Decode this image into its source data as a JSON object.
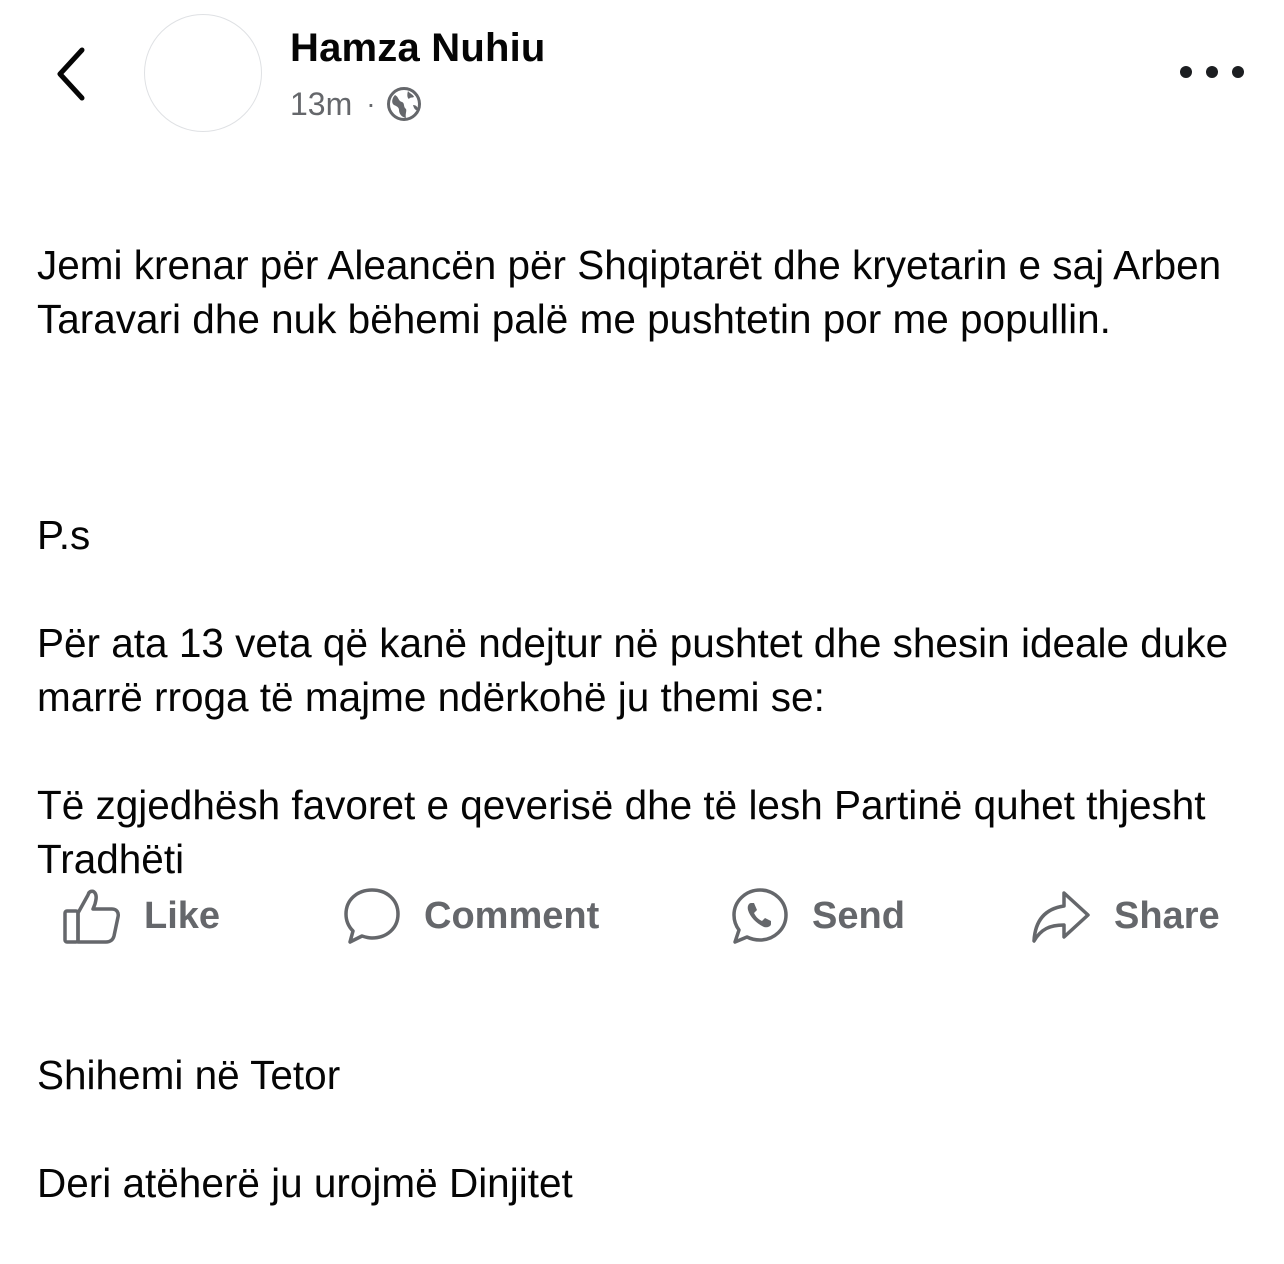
{
  "header": {
    "author": "Hamza Nuhiu",
    "timestamp": "13m",
    "separator": "·",
    "audience_icon": "globe-icon",
    "back_icon": "chevron-left-icon",
    "more_icon": "more-horizontal-icon"
  },
  "post": {
    "paragraphs": [
      "Jemi krenar për Aleancën për Shqiptarët dhe kryetarin e saj Arben Taravari dhe nuk bëhemi palë me pushtetin por me popullin.",
      "P.s",
      "Për ata 13 veta që kanë ndejtur në pushtet dhe shesin ideale duke marrë rroga të majme ndërkohë ju themi se:",
      "Të zgjedhësh favoret e qeverisë dhe të lesh Partinë quhet thjesht Tradhëti",
      "Shihemi në Tetor",
      "Deri atëherë ju urojmë Dinjitet"
    ]
  },
  "actions": {
    "like": "Like",
    "comment": "Comment",
    "send": "Send",
    "share": "Share"
  },
  "colors": {
    "text": "#050505",
    "secondary": "#65676b",
    "background": "#ffffff"
  }
}
